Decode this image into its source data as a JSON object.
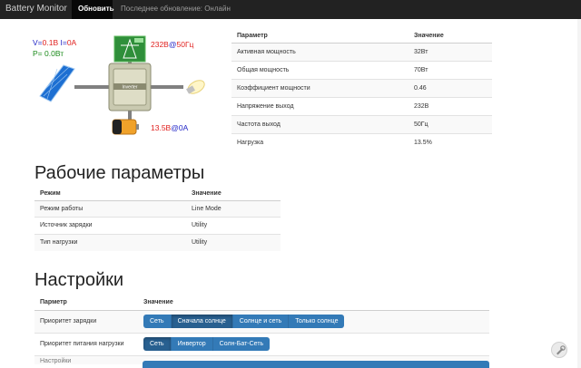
{
  "navbar": {
    "brand": "Battery Monitor",
    "refresh": "Обновить",
    "status": "Последнее обновление: Онлайн"
  },
  "diagram": {
    "pv_v_label": "V=",
    "pv_v_value": "0.1В",
    "pv_i_label": " I=",
    "pv_i_value": "0А",
    "pv_p_label": "P=",
    "pv_p_value": " 0.0Вт",
    "grid_v": "232В",
    "grid_at": "@",
    "grid_f": "50Гц",
    "batt_v": "13.5В",
    "batt_at": "@",
    "batt_i": "0А",
    "inverter_label": "Inverter"
  },
  "output_table": {
    "headers": [
      "Параметр",
      "Значение"
    ],
    "rows": [
      [
        "Активная мощность",
        "32Вт"
      ],
      [
        "Общая мощность",
        "70Вт"
      ],
      [
        "Коэффициент мощности",
        "0.46"
      ],
      [
        "Напряжение выход",
        "232В"
      ],
      [
        "Частота выход",
        "50Гц"
      ],
      [
        "Нагрузка",
        "13.5%"
      ]
    ]
  },
  "work": {
    "title": "Рабочие параметры",
    "headers": [
      "Режим",
      "Значение"
    ],
    "rows": [
      [
        "Режим работы",
        "Line Mode"
      ],
      [
        "Источник зарядки",
        "Utility"
      ],
      [
        "Тип нагрузки",
        "Utility"
      ]
    ]
  },
  "settings": {
    "title": "Настройки",
    "headers": [
      "Парметр",
      "Значение"
    ],
    "charge_priority_label": "Приоритет зарядки",
    "charge_options": [
      "Сеть",
      "Сначала солнце",
      "Солнце и сеть",
      "Только солнце"
    ],
    "load_priority_label": "Приоритет питания нагрузки",
    "load_options": [
      "Сеть",
      "Инвертор",
      "Солн-Бат-Сеть"
    ],
    "cut_row_label": "Настройки"
  },
  "colors": {
    "navbar": "#222222",
    "button": "#337ab7",
    "button_active": "#286090",
    "value_red": "#e0201e",
    "value_blue": "#2226c7",
    "value_green": "#1a8a1a"
  }
}
